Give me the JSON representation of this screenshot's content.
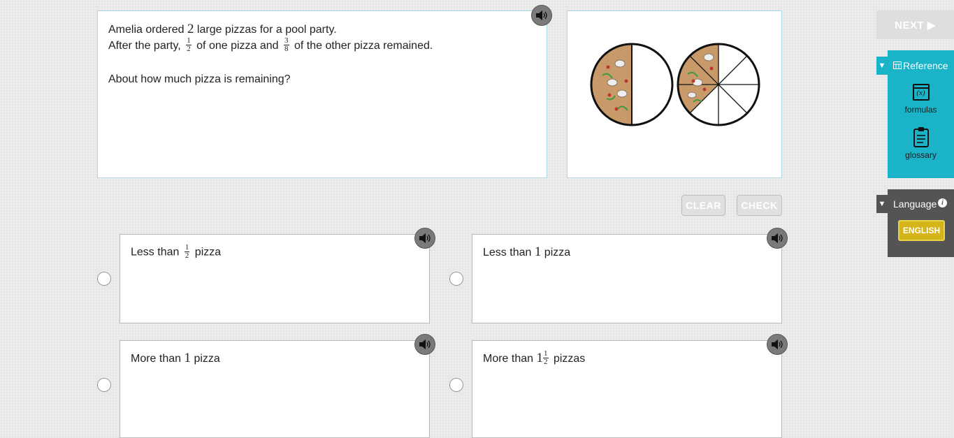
{
  "question": {
    "line1_pre": "Amelia ordered",
    "line1_num": "2",
    "line1_post": "large pizzas for a pool party.",
    "line2_pre": "After the party,",
    "frac1_num": "1",
    "frac1_den": "2",
    "line2_mid": "of one pizza and",
    "frac2_num": "3",
    "frac2_den": "8",
    "line2_post": "of the other pizza remained.",
    "prompt": "About how much pizza is remaining?"
  },
  "pizza_image": {
    "pizza1_slices": 2,
    "pizza1_remaining": 1,
    "pizza2_slices": 8,
    "pizza2_remaining": 3
  },
  "actions": {
    "clear_label": "CLEAR",
    "check_label": "CHECK",
    "next_label": "NEXT ▶"
  },
  "choices": [
    {
      "pre": "Less than",
      "frac_num": "1",
      "frac_den": "2",
      "post": "pizza"
    },
    {
      "pre": "Less than",
      "num": "1",
      "post": "pizza"
    },
    {
      "pre": "More than",
      "num": "1",
      "post": "pizza"
    },
    {
      "pre": "More than",
      "num": "1",
      "frac_num": "1",
      "frac_den": "2",
      "post": "pizzas"
    }
  ],
  "reference": {
    "title": "Reference",
    "formulas_icon_text": "(x)",
    "formulas_label": "formulas",
    "glossary_label": "glossary"
  },
  "language": {
    "title": "Language",
    "info_icon": "i",
    "english_label": "ENGLISH"
  },
  "colors": {
    "accent": "#1ab3c8",
    "crust": "#c89a6a",
    "english_button": "#d4b418"
  }
}
